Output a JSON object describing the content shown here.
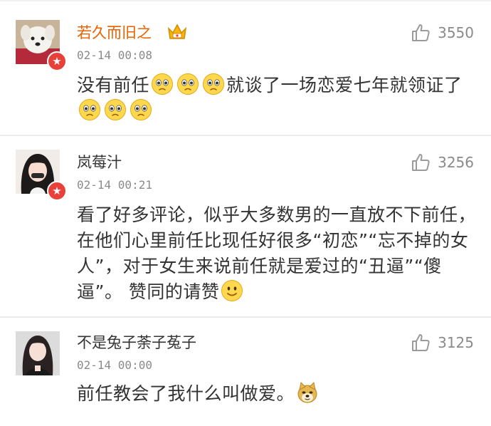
{
  "comments": [
    {
      "username": "若久而旧之",
      "time": "02-14 00:08",
      "likes": "3550",
      "text_a": "没有前任",
      "text_b": "就谈了一场恋爱七年就领",
      "text_c": "证了",
      "name_color": "#eb6100",
      "vip_icon": "crown-icon"
    },
    {
      "username": "岚莓汁",
      "time": "02-14 00:21",
      "likes": "3256",
      "text_a": "看了好多评论，似乎大多数男的一直放不下前任，在他们心里前任比现任好很多“初恋”“忘不掉的女人”，对于女生来说前任就是爱过的“丑逼”“傻逼”。 赞同的请赞",
      "emoji": "smile-emoji"
    },
    {
      "username": "不是兔子荼子菟子",
      "time": "02-14 00:00",
      "likes": "3125",
      "text_a": "前任教会了我什么叫做爱。",
      "emoji": "doge-emoji"
    }
  ],
  "icons": {
    "like": "thumbs-up-icon",
    "badge": "star-badge-icon",
    "sad": "pitiful-face-emoji"
  },
  "colors": {
    "vip_name": "#eb6100",
    "badge": "#e8403a",
    "meta": "#8a8a8a"
  }
}
